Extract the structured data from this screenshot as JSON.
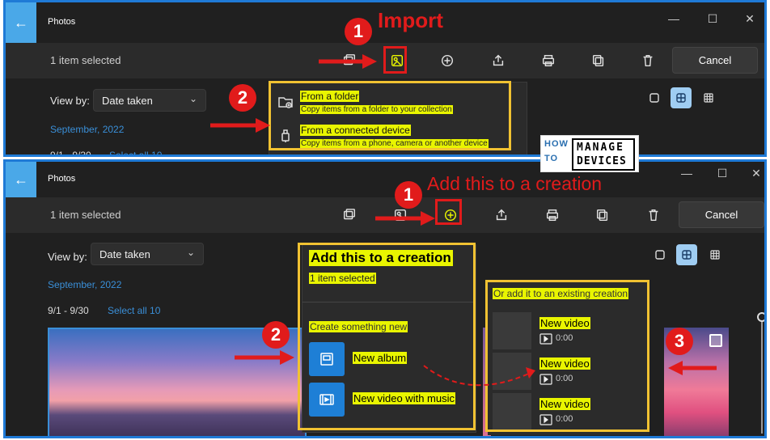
{
  "top": {
    "app_title": "Photos",
    "selection_text": "1 item selected",
    "cancel_label": "Cancel",
    "view_by_label": "View by:",
    "view_by_value": "Date taken",
    "month": "September, 2022",
    "range": "9/1 - 9/30",
    "select_all": "Select all 10",
    "annotation": "Import",
    "step1": "1",
    "step2": "2",
    "menu": [
      {
        "title": "From a folder",
        "subtitle": "Copy items from a folder to your collection"
      },
      {
        "title": "From a connected device",
        "subtitle": "Copy items from a phone, camera or another device"
      }
    ]
  },
  "bottom": {
    "app_title": "Photos",
    "selection_text": "1 item selected",
    "cancel_label": "Cancel",
    "view_by_label": "View by:",
    "view_by_value": "Date taken",
    "month": "September, 2022",
    "range": "9/1 - 9/30",
    "select_all": "Select all 10",
    "annotation": "Add this to a creation",
    "step1": "1",
    "step2": "2",
    "step3": "3",
    "flyout": {
      "title": "Add this to a creation",
      "subtitle": "1 item selected",
      "section": "Create something new",
      "items": [
        {
          "label": "New album"
        },
        {
          "label": "New video with music"
        }
      ]
    },
    "existing": {
      "title": "Or add it to an existing creation",
      "items": [
        {
          "name": "New video",
          "duration": "0:00"
        },
        {
          "name": "New video",
          "duration": "0:00"
        },
        {
          "name": "New video",
          "duration": "0:00"
        }
      ]
    }
  },
  "logo": {
    "how": "HOW",
    "to": "TO",
    "manage": "MANAGE",
    "devices": "DEVICES"
  },
  "colors": {
    "accent": "#1f7ad6",
    "annotation": "#e11b1b",
    "highlight": "#e9f500",
    "frame": "#f1c232"
  }
}
